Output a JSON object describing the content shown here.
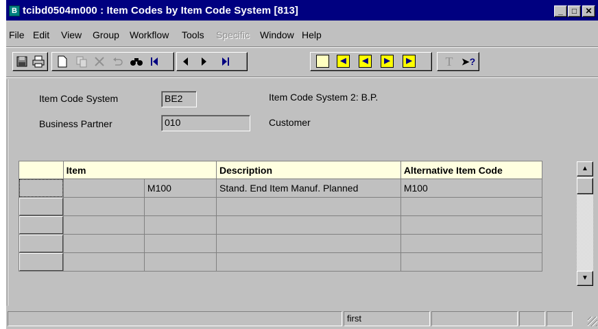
{
  "window": {
    "title": "tcibd0504m000 : Item Codes by Item Code System [813]",
    "app_icon_letter": "B",
    "buttons": {
      "minimize": "_",
      "maximize": "□",
      "close": "✕"
    }
  },
  "menu": [
    {
      "label": "File",
      "enabled": true
    },
    {
      "label": "Edit",
      "enabled": true
    },
    {
      "label": "View",
      "enabled": true
    },
    {
      "label": "Group",
      "enabled": true
    },
    {
      "label": "Workflow",
      "enabled": true
    },
    {
      "label": "Tools",
      "enabled": true
    },
    {
      "label": "Specific",
      "enabled": false
    },
    {
      "label": "Window",
      "enabled": true
    },
    {
      "label": "Help",
      "enabled": true
    }
  ],
  "toolbar": {
    "icons": [
      "save-icon",
      "print-icon",
      "new-icon",
      "copy-icon",
      "delete-icon",
      "undo-icon",
      "find-icon",
      "first-icon",
      "previous-icon",
      "next-icon",
      "last-icon",
      "first-group-icon",
      "previous-group-icon",
      "next-group-icon",
      "last-group-icon",
      "text-icon",
      "context-help-icon"
    ],
    "help_glyph": "?",
    "text_glyph": "T"
  },
  "form": {
    "item_code_system": {
      "label": "Item Code System",
      "value": "BE2",
      "description": "Item Code System 2: B.P."
    },
    "business_partner": {
      "label": "Business Partner",
      "value": "010",
      "description": "Customer"
    }
  },
  "grid": {
    "columns": [
      "Item",
      "Description",
      "Alternative Item Code"
    ],
    "rows": [
      {
        "item_segment_1": "",
        "item_segment_2": "M100",
        "description": "Stand. End Item Manuf. Planned",
        "alt_code": "M100"
      },
      {
        "item_segment_1": "",
        "item_segment_2": "",
        "description": "",
        "alt_code": ""
      },
      {
        "item_segment_1": "",
        "item_segment_2": "",
        "description": "",
        "alt_code": ""
      },
      {
        "item_segment_1": "",
        "item_segment_2": "",
        "description": "",
        "alt_code": ""
      },
      {
        "item_segment_1": "",
        "item_segment_2": "",
        "description": "",
        "alt_code": ""
      }
    ]
  },
  "statusbar": {
    "panes": [
      "",
      "first",
      "",
      "",
      ""
    ]
  },
  "colors": {
    "title_bar": "#000080",
    "face": "#c0c0c0",
    "grid_header": "#ffffe0",
    "toolbar_yellow": "#ffff00"
  }
}
